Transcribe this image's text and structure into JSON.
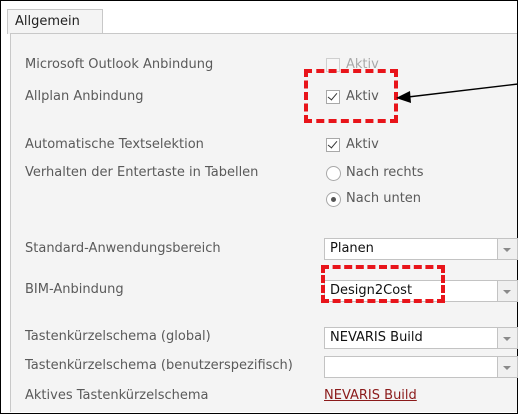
{
  "tab": {
    "label": "Allgemein"
  },
  "rows": {
    "outlook": {
      "label": "Microsoft Outlook Anbindung",
      "option": "Aktiv",
      "checked": false,
      "disabled": true
    },
    "allplan": {
      "label": "Allplan Anbindung",
      "option": "Aktiv",
      "checked": true
    },
    "textselektion": {
      "label": "Automatische Textselektion",
      "option": "Aktiv",
      "checked": true
    },
    "entertaste": {
      "label": "Verhalten der Entertaste in Tabellen",
      "options": [
        "Nach rechts",
        "Nach unten"
      ],
      "selected": "Nach unten"
    },
    "anwendungsbereich": {
      "label": "Standard-Anwendungsbereich",
      "value": "Planen"
    },
    "bim": {
      "label": "BIM-Anbindung",
      "value": "Design2Cost"
    },
    "schema_global": {
      "label": "Tastenkürzelschema (global)",
      "value": "NEVARIS Build"
    },
    "schema_user": {
      "label": "Tastenkürzelschema (benutzerspezifisch)",
      "value": ""
    },
    "schema_aktiv": {
      "label": "Aktives Tastenkürzelschema",
      "value": "NEVARIS Build"
    }
  },
  "colors": {
    "highlight": "#e8141a",
    "link": "#8b1a1a",
    "panel_bg": "#f4f4f4"
  }
}
